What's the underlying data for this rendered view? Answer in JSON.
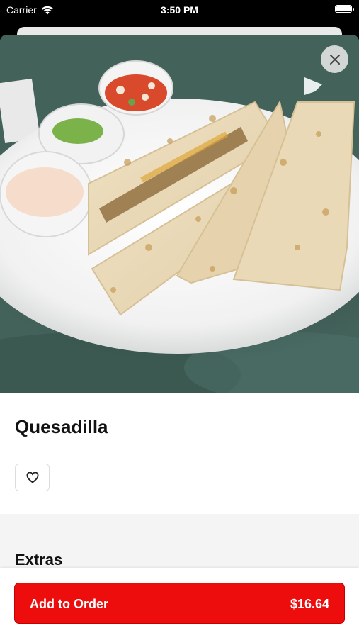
{
  "status_bar": {
    "carrier": "Carrier",
    "time": "3:50 PM"
  },
  "item": {
    "title": "Quesadilla"
  },
  "extras": {
    "heading": "Extras"
  },
  "footer": {
    "add_label": "Add to Order",
    "price": "$16.64"
  },
  "colors": {
    "accent": "#ee0d0d"
  },
  "icons": [
    "wifi-icon",
    "battery-icon",
    "close-icon",
    "heart-icon"
  ]
}
